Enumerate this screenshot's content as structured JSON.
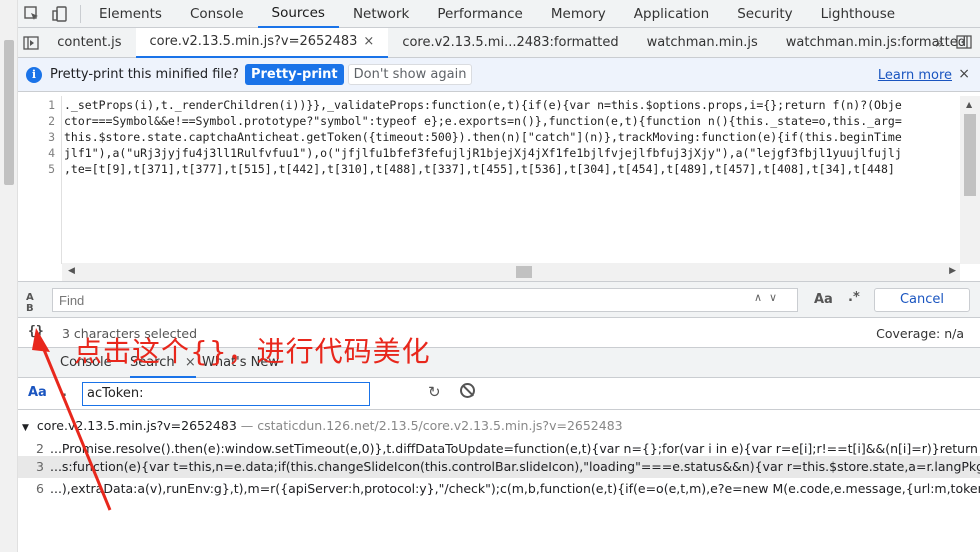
{
  "main_tabs": [
    "Elements",
    "Console",
    "Sources",
    "Network",
    "Performance",
    "Memory",
    "Application",
    "Security",
    "Lighthouse"
  ],
  "active_main_tab": "Sources",
  "file_tabs": [
    {
      "label": "content.js"
    },
    {
      "label": "core.v2.13.5.min.js?v=2652483",
      "close": "×"
    },
    {
      "label": "core.v2.13.5.mi...2483:formatted"
    },
    {
      "label": "watchman.min.js"
    },
    {
      "label": "watchman.min.js:formatted"
    }
  ],
  "more_tabs_glyph": "»",
  "infobar": {
    "icon": "i",
    "text": "Pretty-print this minified file?",
    "pretty_print": "Pretty-print",
    "dont_show": "Don't show again",
    "learn_more": "Learn more",
    "close": "×"
  },
  "code": {
    "line_numbers": [
      "1",
      "2",
      "3",
      "4",
      "5"
    ],
    "lines": [
      "._setProps(i),t._renderChildren(i))}},_validateProps:function(e,t){if(e){var n=this.$options.props,i={};return f(n)?(Obje",
      "ctor===Symbol&&e!==Symbol.prototype?\"symbol\":typeof e};e.exports=n()},function(e,t){function n(){this._state=o,this._arg=",
      "this.$store.state.captchaAnticheat.getToken({timeout:500}).then(n)[\"catch\"](n)},trackMoving:function(e){if(this.beginTime",
      "jlf1\"),a(\"uRj3jyjfu4j3ll1Rulfvfuu1\"),o(\"jfjlfu1bfef3fefujljR1bjejXj4jXf1fe1bjlfvjejlfbfuj3jXjy\"),a(\"lejgf3fbjl1yuujlfujlj",
      ",te=[t[9],t[371],t[377],t[515],t[442],t[310],t[488],t[337],t[455],t[536],t[304],t[454],t[489],t[457],t[408],t[34],t[448]"
    ]
  },
  "find": {
    "placeholder": "Find",
    "case_label": "Aa",
    "regex_label": ".*",
    "cancel": "Cancel"
  },
  "status": {
    "pretty_icon": "{}",
    "selection": "3 characters selected",
    "coverage": "Coverage: n/a"
  },
  "drawer": {
    "tabs": [
      "Console",
      "Search",
      "What's New"
    ],
    "active": "Search",
    "close": "×"
  },
  "search": {
    "case_label": "Aa",
    "regex_label": ".",
    "query": "acToken:"
  },
  "results": {
    "file": "core.v2.13.5.min.js?v=2652483",
    "path": "— cstaticdun.126.net/2.13.5/core.v2.13.5.min.js?v=2652483",
    "lines": [
      {
        "no": "2",
        "text": "...Promise.resolve().then(e):window.setTimeout(e,0)},t.diffDataToUpdate=function(e,t){var n={};for(var i in e){var r=e[i];r!==t[i]&&(n[i]=r)}return n},t.lifeCycleHo"
      },
      {
        "no": "3",
        "text": "...s:function(e){var t=this,n=e.data;if(this.changeSlideIcon(this.controlBar.slideIcon),\"loading\"===e.status&&n){var r=this.$store.state,a=r.langPkg,l=r.config,u"
      },
      {
        "no": "6",
        "text": "...),extraData:a(v),runEnv:g},t),m=r({apiServer:h,protocol:y},\"/check\");c(m,b,function(e,t){if(e=o(e,t,m),e?e=new M(e.code,e.message,{url:m,token:b.token,type:f})"
      }
    ]
  },
  "annotation": {
    "text": "点击这个{}，进行代码美化",
    "color": "#e8271c"
  },
  "colors": {
    "accent": "#1a73e8",
    "toolbar_bg": "#f1f3f4",
    "infobar_bg": "#eef3fc"
  }
}
